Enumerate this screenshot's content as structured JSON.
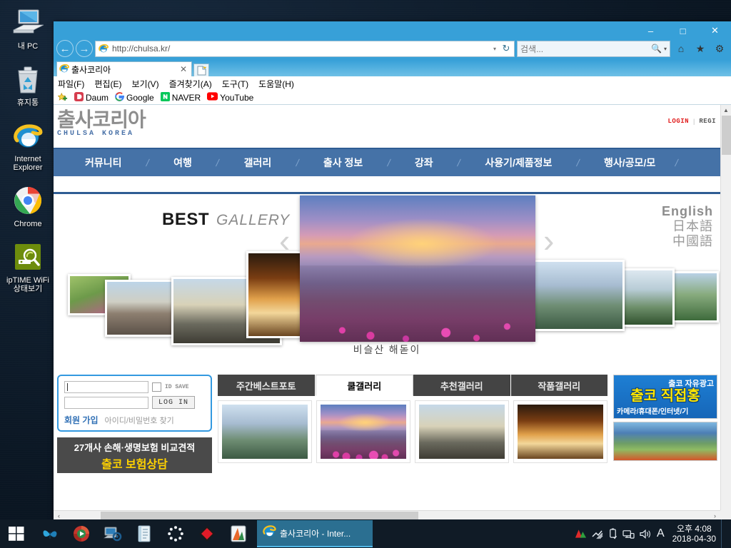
{
  "desktop": {
    "icons": [
      {
        "name": "my-pc",
        "label": "내 PC",
        "icon": "computer-icon"
      },
      {
        "name": "recycle-bin",
        "label": "휴지통",
        "icon": "recycle-bin-icon"
      },
      {
        "name": "internet-explorer",
        "label": "Internet Explorer",
        "icon": "internet-explorer-icon"
      },
      {
        "name": "chrome",
        "label": "Chrome",
        "icon": "chrome-icon"
      },
      {
        "name": "iptime-wifi",
        "label": "ipTIME WiFi 상태보기",
        "icon": "iptime-wifi-icon"
      }
    ]
  },
  "browser": {
    "window_controls": {
      "minimize": "–",
      "maximize": "□",
      "close": "✕"
    },
    "back_label": "←",
    "forward_label": "→",
    "address": {
      "url": "http://chulsa.kr/",
      "dropdown": "▾",
      "refresh": "↻"
    },
    "search": {
      "placeholder": "검색...",
      "icon": "search-icon",
      "dropdown": "▾"
    },
    "toolbar_icons": [
      {
        "name": "home-icon",
        "glyph": "⌂"
      },
      {
        "name": "favorites-icon",
        "glyph": "★"
      },
      {
        "name": "settings-gear-icon",
        "glyph": "⚙"
      }
    ],
    "tab": {
      "title": "출사코리아",
      "close": "✕",
      "favicon": "ie-icon"
    },
    "new_tab_label": "",
    "menu": [
      "파일(F)",
      "편집(E)",
      "보기(V)",
      "즐겨찾기(A)",
      "도구(T)",
      "도움말(H)"
    ],
    "favorites": [
      {
        "name": "favorites-star",
        "label": "",
        "icon": "star-icon"
      },
      {
        "name": "daum",
        "label": "Daum",
        "icon": "daum-icon"
      },
      {
        "name": "google",
        "label": "Google",
        "icon": "google-icon"
      },
      {
        "name": "naver",
        "label": "NAVER",
        "icon": "naver-icon"
      },
      {
        "name": "youtube",
        "label": "YouTube",
        "icon": "youtube-icon"
      }
    ]
  },
  "site": {
    "logo": {
      "main": "출사코리아",
      "sub": "CHULSA KOREA"
    },
    "top_links": {
      "login": "LOGIN",
      "separator": "|",
      "register": "REGI"
    },
    "nav": [
      "커뮤니티",
      "여행",
      "갤러리",
      "출사 정보",
      "강좌",
      "사용기/제품정보",
      "행사/공모/모"
    ],
    "nav_separator": "/",
    "gallery": {
      "title_bold": "BEST",
      "title_italic": "GALLERY",
      "prev_arrow": "‹",
      "next_arrow": "›",
      "caption": "비슬산 해돋이",
      "languages": [
        "English",
        "日本語",
        "中國語"
      ]
    },
    "login_box": {
      "id_value": "",
      "id_placeholder": "",
      "pw_value": "",
      "pw_placeholder": "",
      "id_save_label": "ID SAVE",
      "login_button": "LOG IN",
      "join_link": "회원 가입",
      "find_link": "아이디/비밀번호 찾기"
    },
    "insurance_banner": {
      "line1": "27개사 손해·생명보험 비교견적",
      "line2": "출코 보험상담"
    },
    "gallery_tabs": [
      {
        "label": "주간베스트포토",
        "active": false
      },
      {
        "label": "쿨갤러리",
        "active": true
      },
      {
        "label": "추천갤러리",
        "active": false
      },
      {
        "label": "작품갤러리",
        "active": false
      }
    ],
    "right_banner": {
      "line1": "출코 자유광고",
      "line2": "출코  직접홍",
      "line3": "카메라/휴대폰/인터넷/기"
    },
    "scrollbars": {
      "v_up": "▲",
      "v_down": "▼",
      "h_left": "‹",
      "h_right": "›"
    }
  },
  "taskbar": {
    "start": "start-icon",
    "pinned": [
      {
        "name": "butterfly-app-icon"
      },
      {
        "name": "media-player-icon"
      },
      {
        "name": "network-settings-icon"
      },
      {
        "name": "notepad-app-icon"
      },
      {
        "name": "loading-circle-icon"
      },
      {
        "name": "red-diamond-app-icon"
      },
      {
        "name": "orange-app-icon"
      }
    ],
    "active_window": {
      "label": "출사코리아 - Inter...",
      "icon": "ie-icon"
    },
    "tray": [
      {
        "name": "ahnlab-icon",
        "glyph": "▲"
      },
      {
        "name": "hidden-icons-icon",
        "glyph": "❖"
      },
      {
        "name": "usb-eject-icon",
        "glyph": "⎓"
      },
      {
        "name": "network-icon",
        "glyph": "⬚"
      },
      {
        "name": "volume-icon",
        "glyph": "ᴶ"
      },
      {
        "name": "ime-indicator",
        "glyph": "A"
      }
    ],
    "clock": {
      "time": "오후 4:08",
      "date": "2018-04-30"
    }
  }
}
